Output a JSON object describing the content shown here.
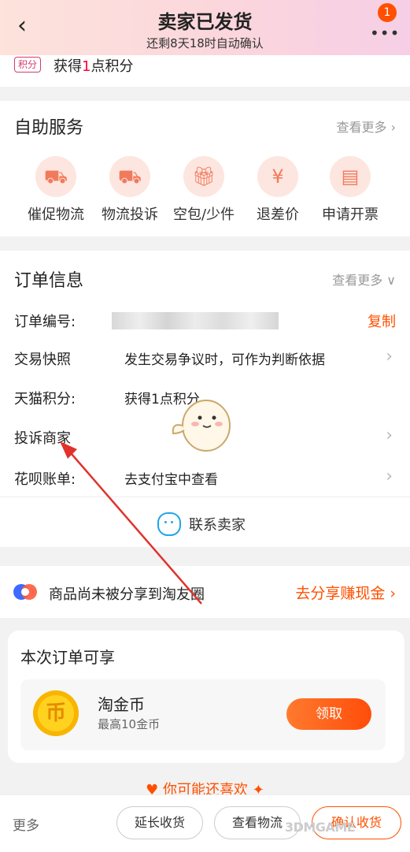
{
  "header": {
    "back_icon": "‹",
    "title": "卖家已发货",
    "subtitle": "还剩8天18时自动确认",
    "menu_icon": "•••",
    "badge_count": "1"
  },
  "points_row": {
    "tag": "积分",
    "prefix": "获得",
    "count": "1",
    "suffix": "点积分"
  },
  "self_service": {
    "title": "自助服务",
    "more": "查看更多 ›",
    "items": [
      {
        "label": "催促物流",
        "icon": "truck-icon"
      },
      {
        "label": "物流投诉",
        "icon": "truck-complaint-icon"
      },
      {
        "label": "空包/少件",
        "icon": "gift-icon"
      },
      {
        "label": "退差价",
        "icon": "yen-refund-icon"
      },
      {
        "label": "申请开票",
        "icon": "invoice-icon"
      }
    ]
  },
  "order_info": {
    "title": "订单信息",
    "more": "查看更多 ∨",
    "rows": [
      {
        "key": "订单编号:",
        "value": "",
        "action": "复制"
      },
      {
        "key": "交易快照",
        "value": "发生交易争议时，可作为判断依据"
      },
      {
        "key": "天猫积分:",
        "value": "获得1点积分"
      },
      {
        "key": "投诉商家",
        "value": ""
      },
      {
        "key": "花呗账单:",
        "value": "去支付宝中查看"
      }
    ],
    "contact": "联系卖家"
  },
  "share": {
    "text": "商品尚未被分享到淘友圈",
    "action": "去分享赚现金",
    "chevron": "›"
  },
  "enjoy": {
    "title": "本次订单可享",
    "coin_symbol": "币",
    "coin_name": "淘金币",
    "coin_sub": "最高10金币",
    "claim": "领取"
  },
  "guess": "♥ 你可能还喜欢 ✦",
  "bottom_bar": {
    "more": "更多",
    "extend": "延长收货",
    "logistics": "查看物流",
    "confirm": "确认收货"
  },
  "watermark": "3DMGAME",
  "colors": {
    "accent": "#ff5000",
    "tmall_red": "#ff0036",
    "service_icon": "#f27a5c",
    "arrow": "#e0322b"
  }
}
